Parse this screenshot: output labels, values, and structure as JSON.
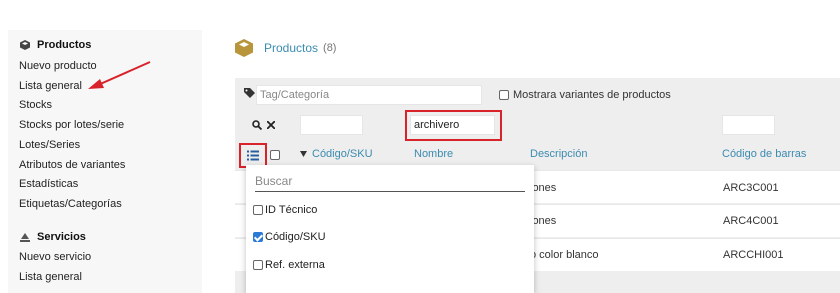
{
  "sidebar": {
    "products_header": "Productos",
    "products_items": [
      "Nuevo producto",
      "Lista general",
      "Stocks",
      "Stocks por lotes/serie",
      "Lotes/Series",
      "Atributos de variantes",
      "Estadísticas",
      "Etiquetas/Categorías"
    ],
    "services_header": "Servicios",
    "services_items": [
      "Nuevo servicio",
      "Lista general"
    ]
  },
  "main": {
    "title": "Productos",
    "count": "(8)"
  },
  "filters": {
    "tag_placeholder": "Tag/Categoría",
    "variants_label": "Mostrara variantes de productos",
    "name_filter_value": "archivero"
  },
  "columns": {
    "code": "Código/SKU",
    "name": "Nombre",
    "description": "Descripción",
    "barcode": "Código de barras"
  },
  "rows": [
    {
      "description": "jones",
      "barcode": "ARC3C001"
    },
    {
      "description": "jones",
      "barcode": "ARC4C001"
    },
    {
      "description": "o color blanco",
      "barcode": "ARCCHI001"
    }
  ],
  "column_menu": {
    "search_placeholder": "Buscar",
    "options": [
      {
        "label": "ID Técnico",
        "checked": false
      },
      {
        "label": "Código/SKU",
        "checked": true
      },
      {
        "label": "Ref. externa",
        "checked": false
      }
    ]
  },
  "colors": {
    "accent": "#3b8bb0",
    "highlight": "#d8232a",
    "checkbox_checked": "#2b7bd6"
  }
}
